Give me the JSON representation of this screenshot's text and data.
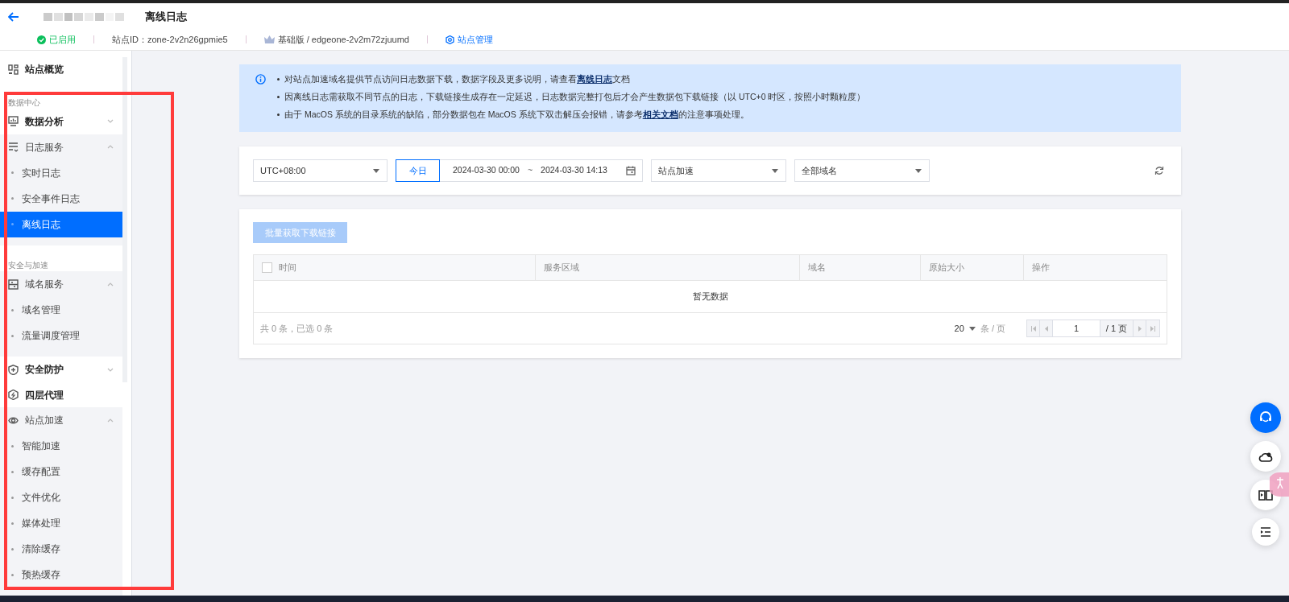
{
  "header": {
    "title": "离线日志",
    "status": {
      "label": "已启用",
      "on": true
    },
    "site_id": "站点ID：zone-2v2n26gpmie5",
    "plan": "基础版 / edgeone-2v2m72zjuumd",
    "manage_link": "站点管理"
  },
  "sidebar": {
    "items": [
      {
        "kind": "link",
        "label": "站点概览",
        "selected": false
      },
      {
        "kind": "section",
        "label": "数据中心"
      },
      {
        "kind": "group",
        "label": "数据分析",
        "expanded": false
      },
      {
        "kind": "group",
        "label": "日志服务",
        "expanded": true,
        "children": [
          {
            "label": "实时日志",
            "selected": false
          },
          {
            "label": "安全事件日志",
            "selected": false
          },
          {
            "label": "离线日志",
            "selected": true
          }
        ]
      },
      {
        "kind": "section",
        "label": "安全与加速"
      },
      {
        "kind": "group",
        "label": "域名服务",
        "expanded": true,
        "children": [
          {
            "label": "域名管理",
            "selected": false
          },
          {
            "label": "流量调度管理",
            "selected": false
          }
        ]
      },
      {
        "kind": "group",
        "label": "安全防护",
        "expanded": false
      },
      {
        "kind": "link",
        "label": "四层代理",
        "selected": false
      },
      {
        "kind": "group",
        "label": "站点加速",
        "expanded": true,
        "children": [
          {
            "label": "智能加速",
            "selected": false
          },
          {
            "label": "缓存配置",
            "selected": false
          },
          {
            "label": "文件优化",
            "selected": false
          },
          {
            "label": "媒体处理",
            "selected": false
          },
          {
            "label": "清除缓存",
            "selected": false
          },
          {
            "label": "预热缓存",
            "selected": false
          }
        ]
      }
    ]
  },
  "notice": {
    "notes": [
      {
        "before": "对站点加速域名提供节点访问日志数据下载，数据字段及更多说明，请查看",
        "link": "离线日志",
        "after": "文档"
      },
      {
        "before": "因离线日志需获取不同节点的日志，下载链接生成存在一定延迟，日志数据完整打包后才会产生数据包下载链接（以 UTC+0 时区，按照小时颗粒度）"
      },
      {
        "before": "由于 MacOS 系统的目录系统的缺陷，部分数据包在 MacOS 系统下双击解压会报错，请参考",
        "link": "相关文档",
        "after": "的注意事项处理。"
      }
    ]
  },
  "filters": {
    "timezone": "UTC+08:00",
    "quick_range": {
      "label": "今日",
      "selected": true
    },
    "start": "2024-03-30 00:00",
    "separator": "~",
    "end": "2024-03-30 14:13",
    "service": "站点加速",
    "domain": "全部域名"
  },
  "table": {
    "batch_button": {
      "label": "批量获取下载链接",
      "disabled": true
    },
    "select_all": {
      "checked": false
    },
    "columns": [
      "时间",
      "服务区域",
      "域名",
      "原始大小",
      "操作"
    ],
    "empty_text": "暂无数据",
    "summary": "共 0 条，已选 0 条",
    "pagination": {
      "page_size": "20",
      "page_size_unit": "条 / 页",
      "page": "1",
      "total_pages": "/ 1 页"
    }
  },
  "annotation": {
    "kind": "rectangle",
    "color": "#ff3b3b"
  }
}
